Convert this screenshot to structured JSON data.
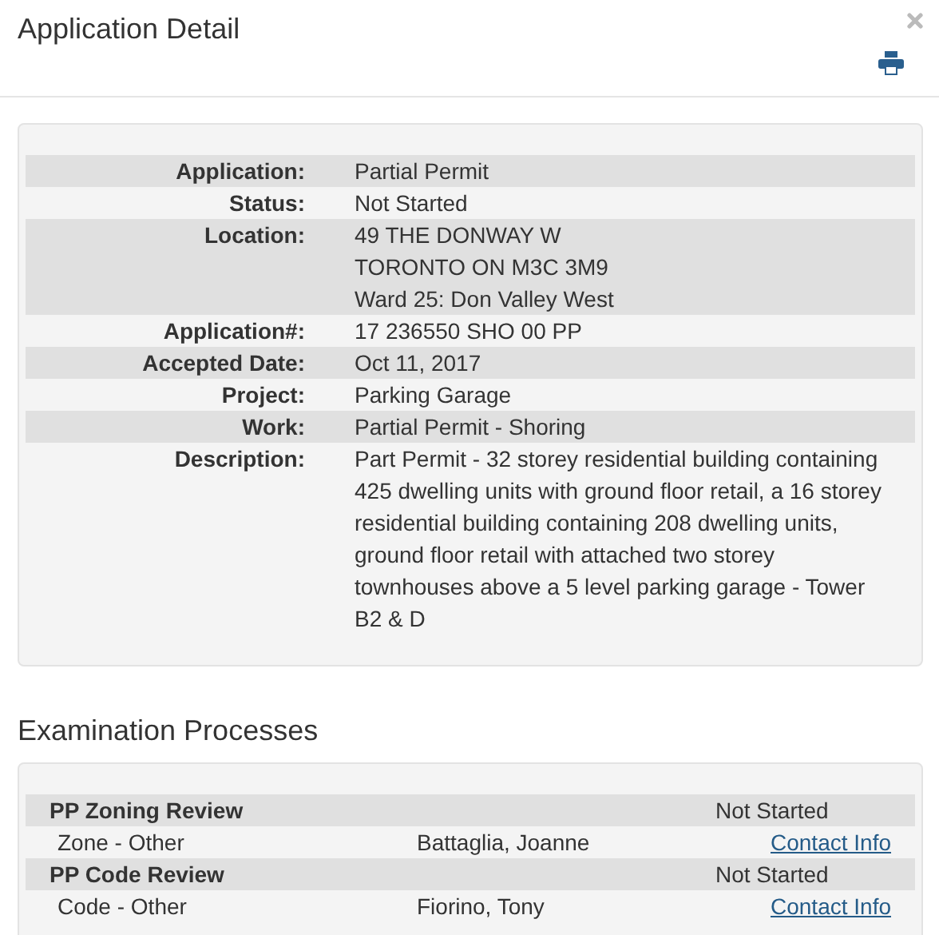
{
  "dialog": {
    "title": "Application Detail"
  },
  "details": [
    {
      "label": "Application:",
      "lines": [
        "Partial Permit"
      ]
    },
    {
      "label": "Status:",
      "lines": [
        "Not Started"
      ]
    },
    {
      "label": "Location:",
      "lines": [
        "49 THE DONWAY W",
        "TORONTO ON M3C 3M9",
        "Ward 25: Don Valley West"
      ]
    },
    {
      "label": "Application#:",
      "lines": [
        "17 236550 SHO 00 PP"
      ]
    },
    {
      "label": "Accepted Date:",
      "lines": [
        "Oct 11, 2017"
      ]
    },
    {
      "label": "Project:",
      "lines": [
        "Parking Garage"
      ]
    },
    {
      "label": "Work:",
      "lines": [
        "Partial Permit - Shoring"
      ]
    },
    {
      "label": "Description:",
      "lines": [
        "Part Permit - 32 storey residential building containing 425 dwelling units with ground floor retail, a 16 storey residential building containing 208 dwelling units, ground floor retail with attached two storey townhouses above a 5 level parking garage - Tower B2 & D"
      ]
    }
  ],
  "examination": {
    "heading": "Examination Processes",
    "processes": [
      {
        "name": "PP Zoning Review",
        "status": "Not Started",
        "type": "Zone - Other",
        "examiner": "Battaglia, Joanne",
        "link": "Contact Info"
      },
      {
        "name": "PP Code Review",
        "status": "Not Started",
        "type": "Code - Other",
        "examiner": "Fiorino, Tony",
        "link": "Contact Info"
      }
    ]
  }
}
